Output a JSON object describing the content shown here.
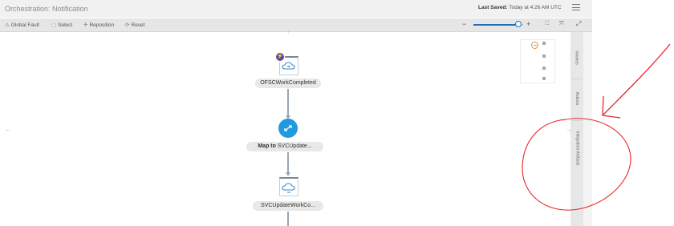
{
  "header": {
    "title": "Orchestration: Notification",
    "last_saved_label": "Last Saved:",
    "last_saved_value": "Today at 4:26 AM UTC"
  },
  "toolbar": {
    "global_fault": "Global Fault",
    "select": "Select",
    "reposition": "Reposition",
    "reset": "Reset",
    "zoom_level": 0.9
  },
  "nodes": [
    {
      "label": "OFSCWorkCompleted",
      "type": "trigger",
      "icon": "cloud-connection-icon"
    },
    {
      "label_bold": "Map to",
      "label": " SVCUpdate...",
      "type": "map",
      "icon": "mapper-icon"
    },
    {
      "label": "SVCUpdateWorkCo...",
      "type": "invoke",
      "icon": "cloud-connection-icon"
    }
  ],
  "side_panel": {
    "tabs": [
      "Invokes",
      "Actions",
      "Integration Artifacts"
    ]
  },
  "colors": {
    "map_node": "#1f9ae0",
    "trigger_badge": "#5b4a9e",
    "zoom_slider": "#1d6fb8",
    "annotation": "#e8262b"
  }
}
